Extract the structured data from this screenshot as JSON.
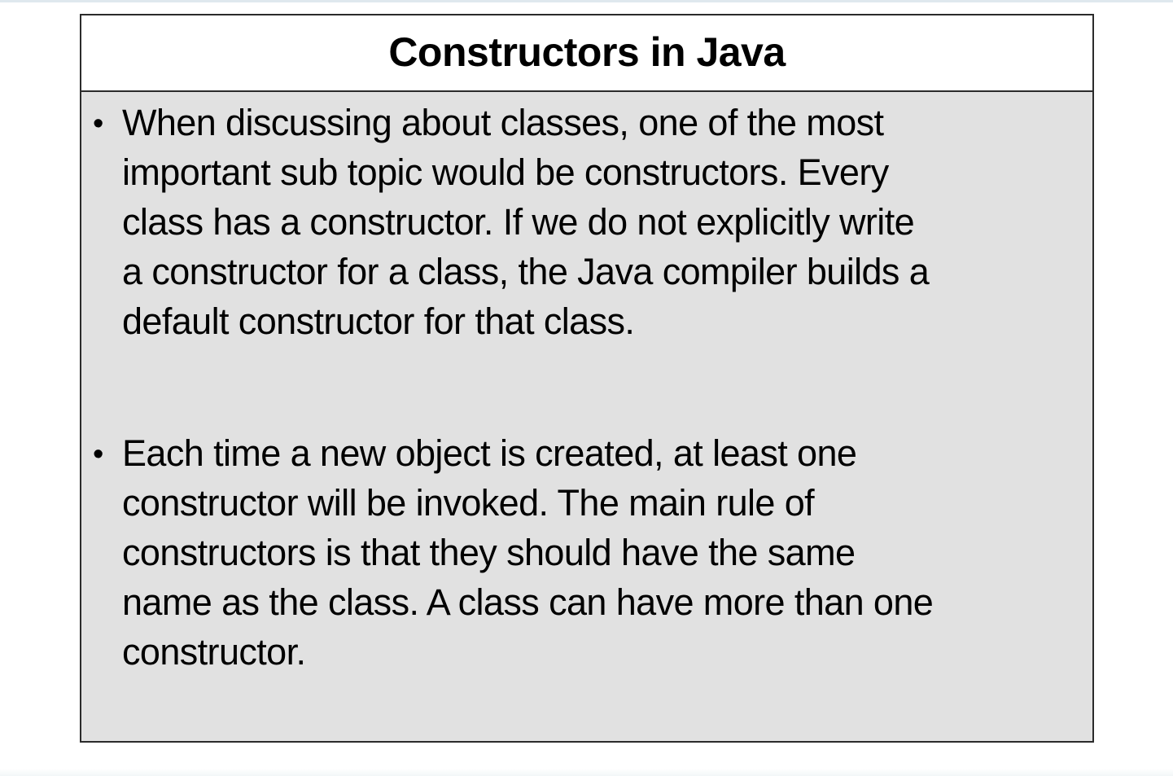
{
  "slide": {
    "title": "Constructors in Java",
    "bullets": [
      {
        "lines": [
          "When discussing about classes, one of the most",
          "important sub topic would be constructors. Every",
          "class has a constructor. If we do not explicitly write",
          "a constructor for a class, the Java compiler builds a",
          "default constructor for that class."
        ]
      },
      {
        "lines": [
          "Each time a new object is created, at least one",
          "constructor will be invoked. The main rule of",
          "constructors is that they should have the same",
          "name as the class. A class can have more than one",
          "constructor."
        ]
      }
    ]
  }
}
